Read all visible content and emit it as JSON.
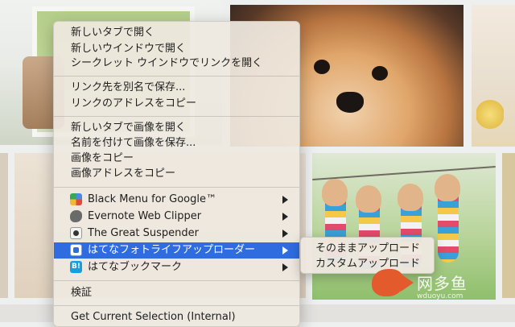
{
  "menu": {
    "items": [
      {
        "label": "新しいタブで開く"
      },
      {
        "label": "新しいウインドウで開く"
      },
      {
        "label": "シークレット ウインドウでリンクを開く"
      },
      {
        "label": "リンク先を別名で保存..."
      },
      {
        "label": "リンクのアドレスをコピー"
      },
      {
        "label": "新しいタブで画像を開く"
      },
      {
        "label": "名前を付けて画像を保存..."
      },
      {
        "label": "画像をコピー"
      },
      {
        "label": "画像アドレスをコピー"
      },
      {
        "label": "Black Menu for Google™",
        "icon": "black-menu-icon"
      },
      {
        "label": "Evernote Web Clipper",
        "icon": "evernote-icon"
      },
      {
        "label": "The Great Suspender",
        "icon": "great-suspender-icon"
      },
      {
        "label": "はてなフォトライフアップローダー",
        "icon": "hatena-fotolife-icon"
      },
      {
        "label": "はてなブックマーク",
        "icon": "hatena-bookmark-icon",
        "icon_text": "B!"
      },
      {
        "label": "検証"
      },
      {
        "label": "Get Current Selection (Internal)"
      }
    ]
  },
  "submenu": {
    "items": [
      {
        "label": "そのままアップロード"
      },
      {
        "label": "カスタムアップロード"
      }
    ]
  },
  "watermark": {
    "title": "网多鱼",
    "url": "wduoyu.com"
  },
  "colors": {
    "highlight": "#2f6ce0",
    "watermark_fish": "#e35a2c"
  }
}
